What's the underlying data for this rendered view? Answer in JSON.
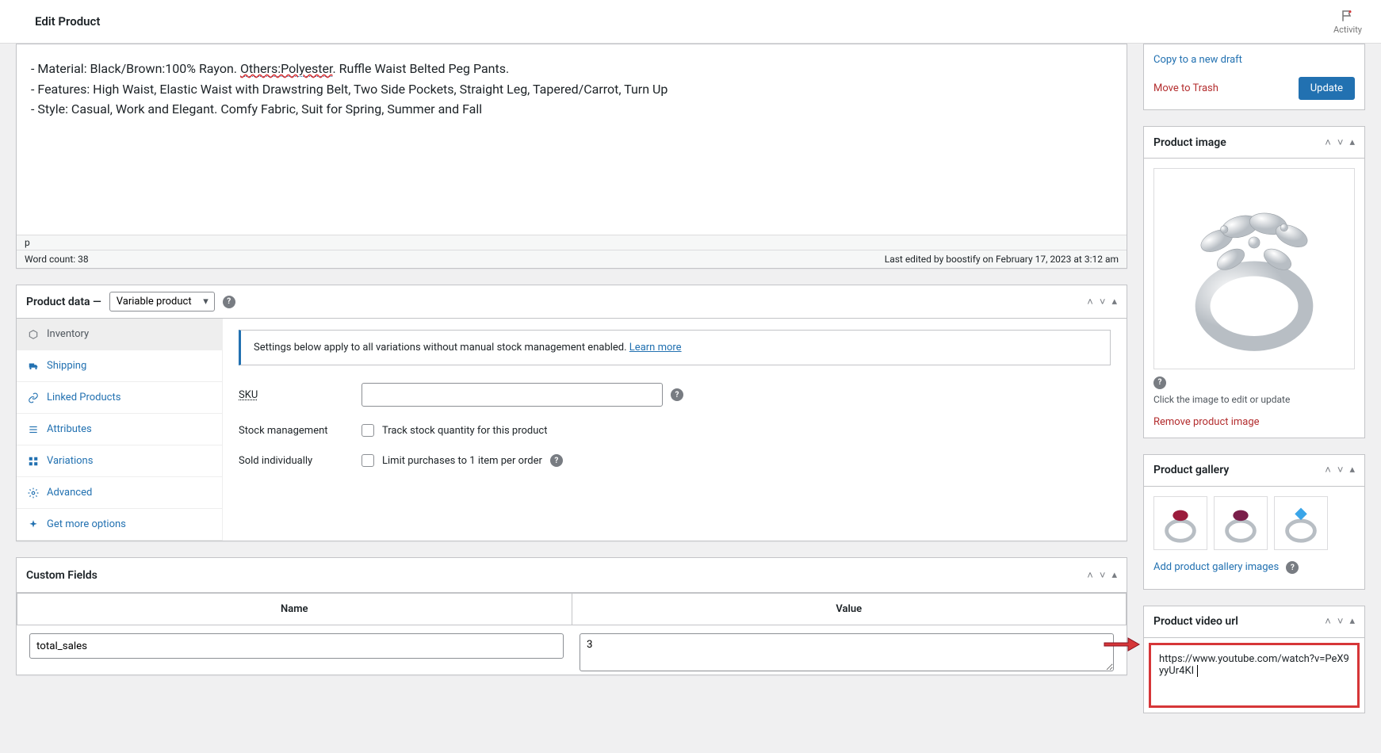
{
  "header": {
    "title": "Edit Product",
    "activity": "Activity"
  },
  "editor": {
    "line1_prefix": "- Material: Black/Brown:100% Rayon. ",
    "line1_highlight": "Others:Polyester",
    "line1_suffix": ". Ruffle Waist Belted Peg Pants.",
    "line2": "- Features: High Waist, Elastic Waist with Drawstring Belt, Two Side Pockets, Straight Leg, Tapered/Carrot, Turn Up",
    "line3": "- Style: Casual, Work and Elegant. Comfy Fabric, Suit for Spring, Summer and Fall",
    "path": "p",
    "word_count": "Word count: 38",
    "last_edited": "Last edited by boostify on February 17, 2023 at 3:12 am"
  },
  "product_data": {
    "title": "Product data",
    "dash": "—",
    "type": "Variable product",
    "tabs": [
      "Inventory",
      "Shipping",
      "Linked Products",
      "Attributes",
      "Variations",
      "Advanced",
      "Get more options"
    ],
    "notice_text": "Settings below apply to all variations without manual stock management enabled. ",
    "notice_link": "Learn more",
    "sku_label": "SKU",
    "stock_mgmt_label": "Stock management",
    "stock_mgmt_cb": "Track stock quantity for this product",
    "sold_ind_label": "Sold individually",
    "sold_ind_cb": "Limit purchases to 1 item per order"
  },
  "custom_fields": {
    "title": "Custom Fields",
    "name_header": "Name",
    "value_header": "Value",
    "rows": [
      {
        "name": "total_sales",
        "value": "3"
      }
    ]
  },
  "sidebar": {
    "publish": {
      "copy": "Copy to a new draft",
      "trash": "Move to Trash",
      "update": "Update"
    },
    "product_image": {
      "title": "Product image",
      "click_hint": "Click the image to edit or update",
      "remove": "Remove product image"
    },
    "product_gallery": {
      "title": "Product gallery",
      "add": "Add product gallery images"
    },
    "video_url": {
      "title": "Product video url",
      "value": "https://www.youtube.com/watch?v=PeX9yyUr4KI"
    }
  }
}
